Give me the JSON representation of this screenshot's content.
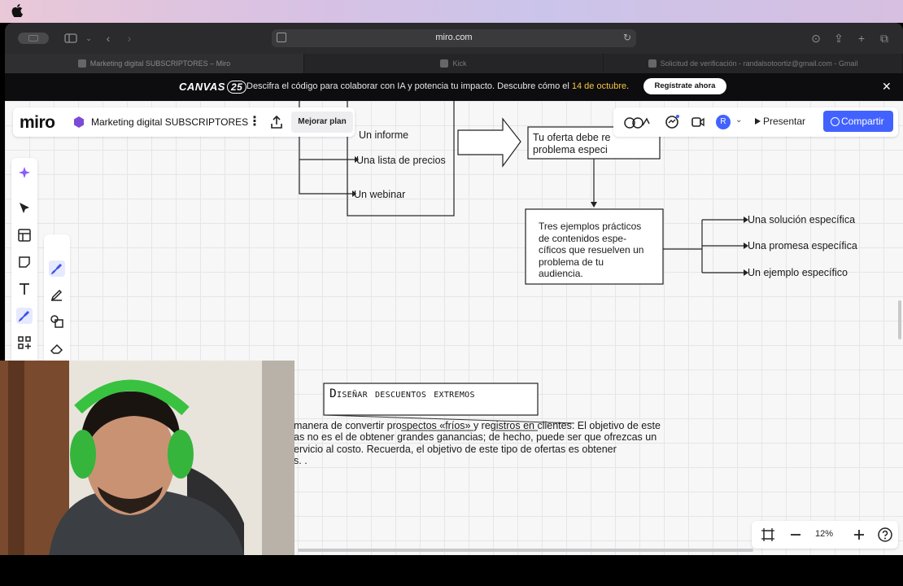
{
  "browser": {
    "url": "miro.com",
    "tabs": [
      {
        "label": "Marketing digital SUBSCRIPTORES – Miro",
        "active": true
      },
      {
        "label": "Kick",
        "active": false
      },
      {
        "label": "Solicitud de verificación - randalsotoortiz@gmail.com - Gmail",
        "active": false
      }
    ]
  },
  "banner": {
    "logo_text": "CANVAS",
    "logo_badge": "25",
    "text_before": "Descifra el código para colaborar con IA y potencia tu impacto. Descubre cómo el ",
    "highlight": "14 de octubre",
    "text_after": ".",
    "cta": "Regístrate ahora"
  },
  "topbar": {
    "logo": "miro",
    "board_name": "Marketing digital SUBSCRIPTORES",
    "upgrade_label": "Mejorar plan",
    "avatar_initial": "R",
    "present_label": "Presentar",
    "share_label": "Compartir"
  },
  "board": {
    "left_list": [
      "Un informe",
      "Una lista de precios",
      "Un webinar"
    ],
    "offer_box": [
      "Tu oferta debe re",
      "problema especi"
    ],
    "examples_box": [
      "Tres ejemplos prácticos",
      "de contenidos espe-",
      "cíficos que resuelven un",
      "problema de tu",
      "audiencia."
    ],
    "right_list": [
      "Una solución específica",
      "Una promesa específica",
      "Un ejemplo específico"
    ],
    "heading": "Diseñar descuentos extremos",
    "paragraph": [
      "manera de convertir prospectos «fríos» y registros en clientes. El objetivo de este",
      "as no es el de obtener grandes ganancias; de hecho, puede ser que ofrezcas un",
      "ervicio al costo. Recuerda, el objetivo de este tipo de ofertas es obtener",
      "s.         ."
    ]
  },
  "zoom": {
    "value": "12%"
  },
  "colors": {
    "accent": "#4262ff",
    "banner_highlight": "#f5c542",
    "board_bg": "#f7f7f8"
  }
}
